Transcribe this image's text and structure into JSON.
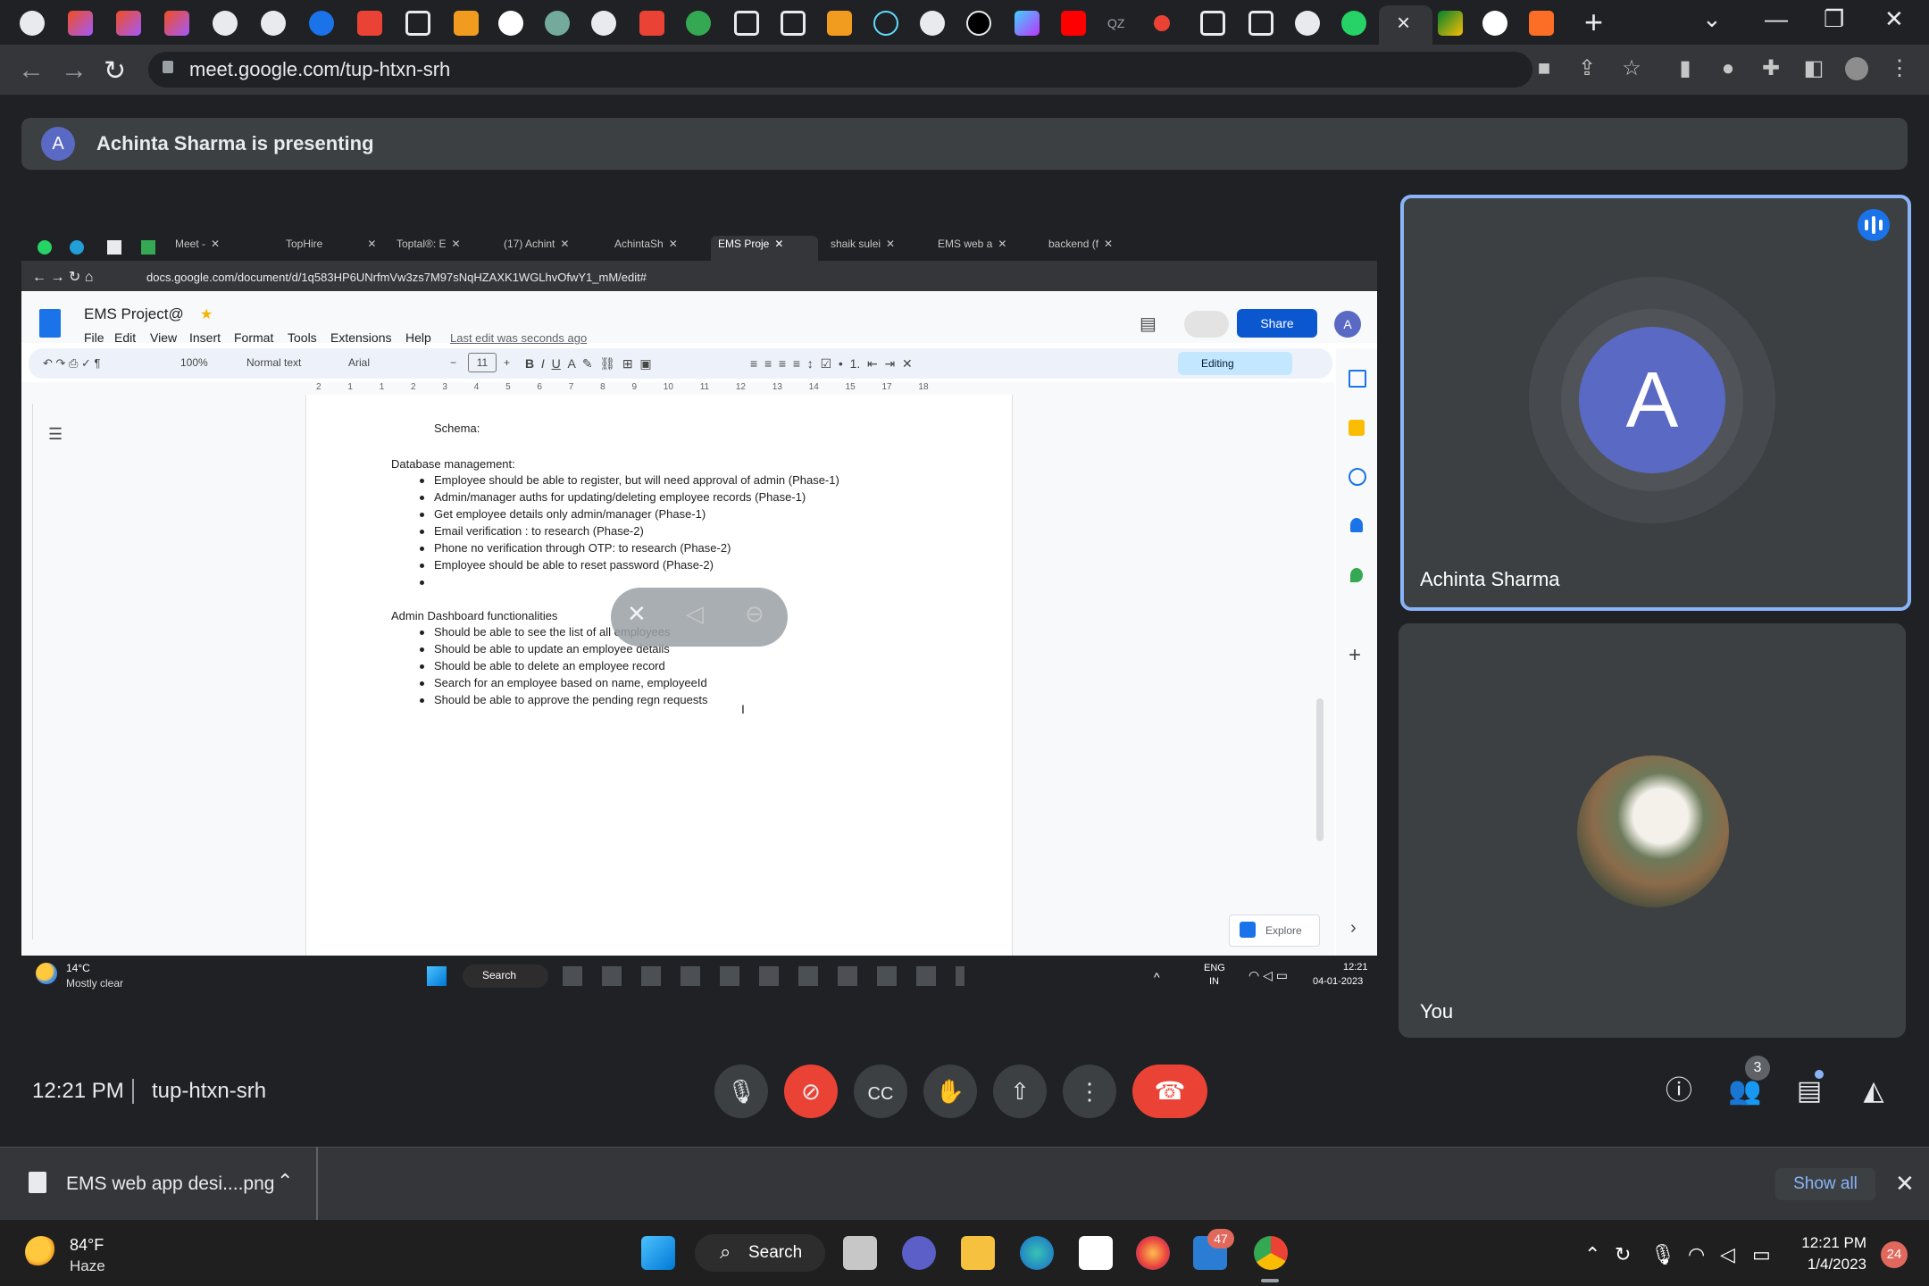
{
  "browser": {
    "url": "meet.google.com/tup-htxn-srh",
    "tab_icons": [
      "app-icon",
      "figma-icon",
      "figma-icon",
      "figma-icon",
      "github-icon",
      "github-icon",
      "app-icon",
      "app-icon",
      "app-icon",
      "app-icon",
      "google-icon",
      "chatgpt-icon",
      "github-icon",
      "app-icon",
      "check-icon",
      "app-icon",
      "app-icon",
      "app-icon",
      "react-icon",
      "chrome-icon",
      "app-icon",
      "vite-icon",
      "youtube-icon",
      "qz-icon",
      "app-icon",
      "app-icon",
      "app-icon",
      "github-icon",
      "whatsapp-icon",
      "meet-icon",
      "meet-icon",
      "google-icon",
      "gitlab-icon"
    ],
    "qz_label": "QZ",
    "active_tab_close": "×",
    "new_tab": "+"
  },
  "meet": {
    "presenting_avatar": "A",
    "presenting_text": "Achinta Sharma is presenting",
    "tiles": [
      {
        "avatar": "A",
        "name": "Achinta Sharma"
      },
      {
        "name": "You"
      }
    ],
    "time": "12:21 PM",
    "code": "tup-htxn-srh",
    "people_count": "3"
  },
  "shared_screen": {
    "tabs": [
      "Meet -",
      "TopHire",
      "Toptal®: E",
      "(17) Achint",
      "AchintaSh",
      "EMS Proje",
      "shaik sulei",
      "EMS web a",
      "backend (f"
    ],
    "url": "docs.google.com/document/d/1q583HP6UNrfmVw3zs7M97sNqHZAXK1WGLhvOfwY1_mM/edit#",
    "doc_title": "EMS Project@",
    "menu": [
      "File",
      "Edit",
      "View",
      "Insert",
      "Format",
      "Tools",
      "Extensions",
      "Help"
    ],
    "last_edit": "Last edit was seconds ago",
    "share_label": "Share",
    "account_avatar": "A",
    "zoom": "100%",
    "style": "Normal text",
    "font": "Arial",
    "font_size": "11",
    "editing": "Editing",
    "ruler": [
      "2",
      "1",
      "1",
      "2",
      "3",
      "4",
      "5",
      "6",
      "7",
      "8",
      "9",
      "10",
      "11",
      "12",
      "13",
      "14",
      "15",
      "17",
      "18"
    ],
    "doc": {
      "schema": "Schema:",
      "section1_title": "Database management:",
      "section1_items": [
        "Employee should be able to register, but will need approval of admin  (Phase-1)",
        "Admin/manager auths for updating/deleting employee records  (Phase-1)",
        "Get employee details only admin/manager  (Phase-1)",
        "Email verification : to research  (Phase-2)",
        "Phone no verification through OTP: to research  (Phase-2)",
        "Employee should be able to reset password (Phase-2)",
        ""
      ],
      "section2_title": "Admin Dashboard functionalities",
      "section2_items": [
        "Should be able to see the list of all employees",
        "Should be able to update an employee details",
        "Should be able to delete an employee record",
        "Search for an employee based on name, employeeId",
        "Should be able to approve the pending regn requests"
      ]
    },
    "explore": "Explore",
    "taskbar": {
      "weather_temp": "14°C",
      "weather_cond": "Mostly clear",
      "search": "Search",
      "lang1": "ENG",
      "lang2": "IN",
      "time": "12:21",
      "date": "04-01-2023"
    }
  },
  "downloads": {
    "file": "EMS web app desi....png",
    "show_all": "Show all"
  },
  "taskbar": {
    "weather_temp": "84°F",
    "weather_cond": "Haze",
    "search": "Search",
    "teams_badge": "47",
    "time": "12:21 PM",
    "date": "1/4/2023",
    "notif_count": "24"
  },
  "colors": {
    "accent": "#8ab4f8",
    "end_call": "#ea4335",
    "avatar": "#5a6ac4",
    "docs_share": "#0b57d0"
  }
}
